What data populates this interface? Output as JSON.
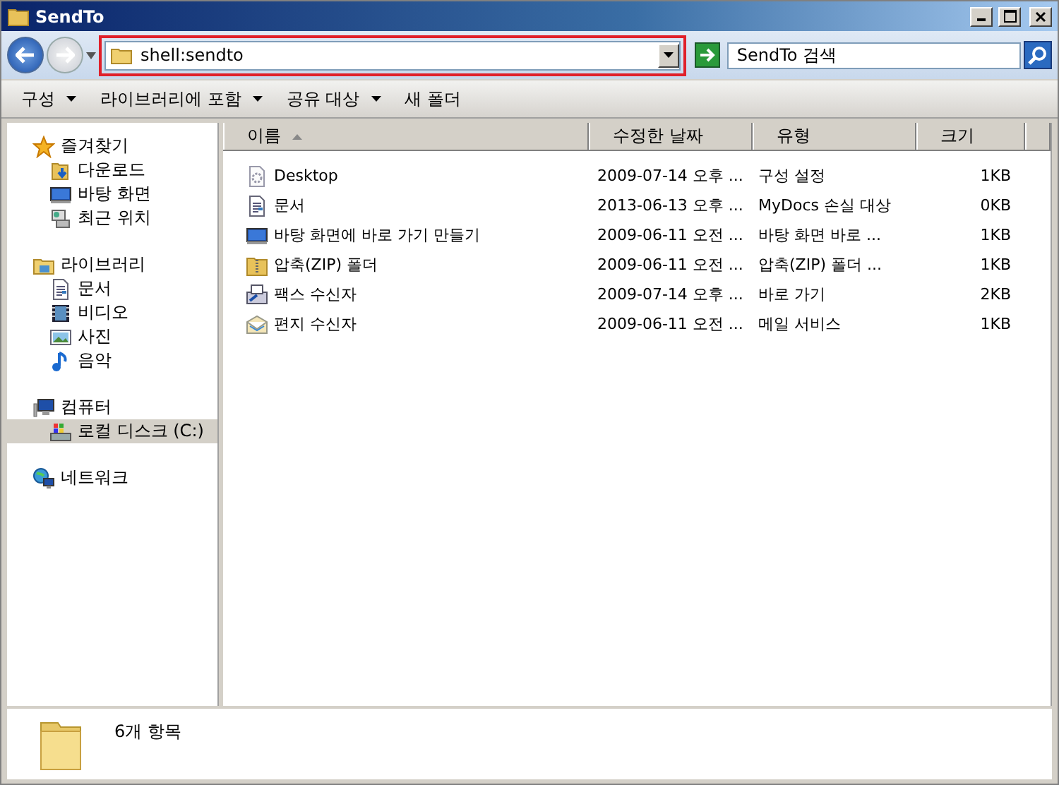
{
  "window": {
    "title": "SendTo"
  },
  "address_bar": {
    "value": "shell:sendto",
    "highlighted": true
  },
  "search": {
    "placeholder": "SendTo 검색"
  },
  "toolbar": [
    {
      "label": "구성",
      "dropdown": true
    },
    {
      "label": "라이브러리에 포함",
      "dropdown": true
    },
    {
      "label": "공유 대상",
      "dropdown": true
    },
    {
      "label": "새 폴더",
      "dropdown": false
    }
  ],
  "sidebar": {
    "groups": [
      {
        "label": "즐겨찾기",
        "kind": "star",
        "children": [
          {
            "label": "다운로드",
            "kind": "download",
            "selected": false
          },
          {
            "label": "바탕 화면",
            "kind": "desktop",
            "selected": false
          },
          {
            "label": "최근 위치",
            "kind": "recent",
            "selected": false
          }
        ]
      },
      {
        "label": "라이브러리",
        "kind": "library",
        "children": [
          {
            "label": "문서",
            "kind": "document",
            "selected": false
          },
          {
            "label": "비디오",
            "kind": "video",
            "selected": false
          },
          {
            "label": "사진",
            "kind": "picture",
            "selected": false
          },
          {
            "label": "음악",
            "kind": "music",
            "selected": false
          }
        ]
      },
      {
        "label": "컴퓨터",
        "kind": "computer",
        "children": [
          {
            "label": "로컬 디스크 (C:)",
            "kind": "drive",
            "selected": true
          }
        ]
      },
      {
        "label": "네트워크",
        "kind": "network"
      }
    ]
  },
  "table": {
    "columns": [
      {
        "label": "이름",
        "sorted": true
      },
      {
        "label": "수정한 날짜",
        "sorted": false
      },
      {
        "label": "유형",
        "sorted": false
      },
      {
        "label": "크기",
        "sorted": false
      }
    ],
    "rows": [
      {
        "kind": "settings",
        "name": "Desktop",
        "date": "2009-07-14 오후 ...",
        "type": "구성 설정",
        "size": "1KB"
      },
      {
        "kind": "document",
        "name": "문서",
        "date": "2013-06-13 오후 ...",
        "type": "MyDocs 손실 대상",
        "size": "0KB"
      },
      {
        "kind": "desktop",
        "name": "바탕 화면에 바로 가기 만들기",
        "date": "2009-06-11 오전 ...",
        "type": "바탕 화면 바로 ...",
        "size": "1KB"
      },
      {
        "kind": "zip",
        "name": "압축(ZIP) 폴더",
        "date": "2009-06-11 오전 ...",
        "type": "압축(ZIP) 폴더 ...",
        "size": "1KB"
      },
      {
        "kind": "fax",
        "name": "팩스 수신자",
        "date": "2009-07-14 오후 ...",
        "type": "바로 가기",
        "size": "2KB"
      },
      {
        "kind": "mail",
        "name": "편지 수신자",
        "date": "2009-06-11 오전 ...",
        "type": "메일 서비스",
        "size": "1KB"
      }
    ]
  },
  "status_bar": {
    "item_count": "6개 항목"
  }
}
